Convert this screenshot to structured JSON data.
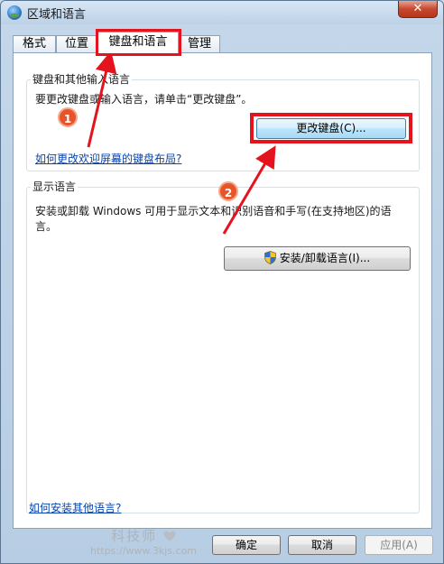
{
  "window": {
    "title": "区域和语言",
    "close_glyph": "✕"
  },
  "tabs": [
    {
      "label": "格式"
    },
    {
      "label": "位置"
    },
    {
      "label": "键盘和语言"
    },
    {
      "label": "管理"
    }
  ],
  "keyboard_group": {
    "title": "键盘和其他输入语言",
    "description": "要更改键盘或输入语言，请单击“更改键盘”。",
    "change_keyboard_button": "更改键盘(C)...",
    "welcome_layout_link": "如何更改欢迎屏幕的键盘布局?"
  },
  "display_group": {
    "title": "显示语言",
    "description_line1": "安装或卸载 Windows 可用于显示文本和识别语音和手写(在支持地区)的语",
    "description_line2": "言。",
    "install_button": "安装/卸载语言(I)..."
  },
  "bottom_link": "如何安装其他语言?",
  "footer": {
    "ok": "确定",
    "cancel": "取消",
    "apply": "应用(A)"
  },
  "annotations": {
    "step1": "1",
    "step2": "2",
    "highlight_color": "#e3141d",
    "badge_color": "#e8542a"
  },
  "watermark": {
    "name": "科技师",
    "url": "https://www.3kjs.com"
  }
}
